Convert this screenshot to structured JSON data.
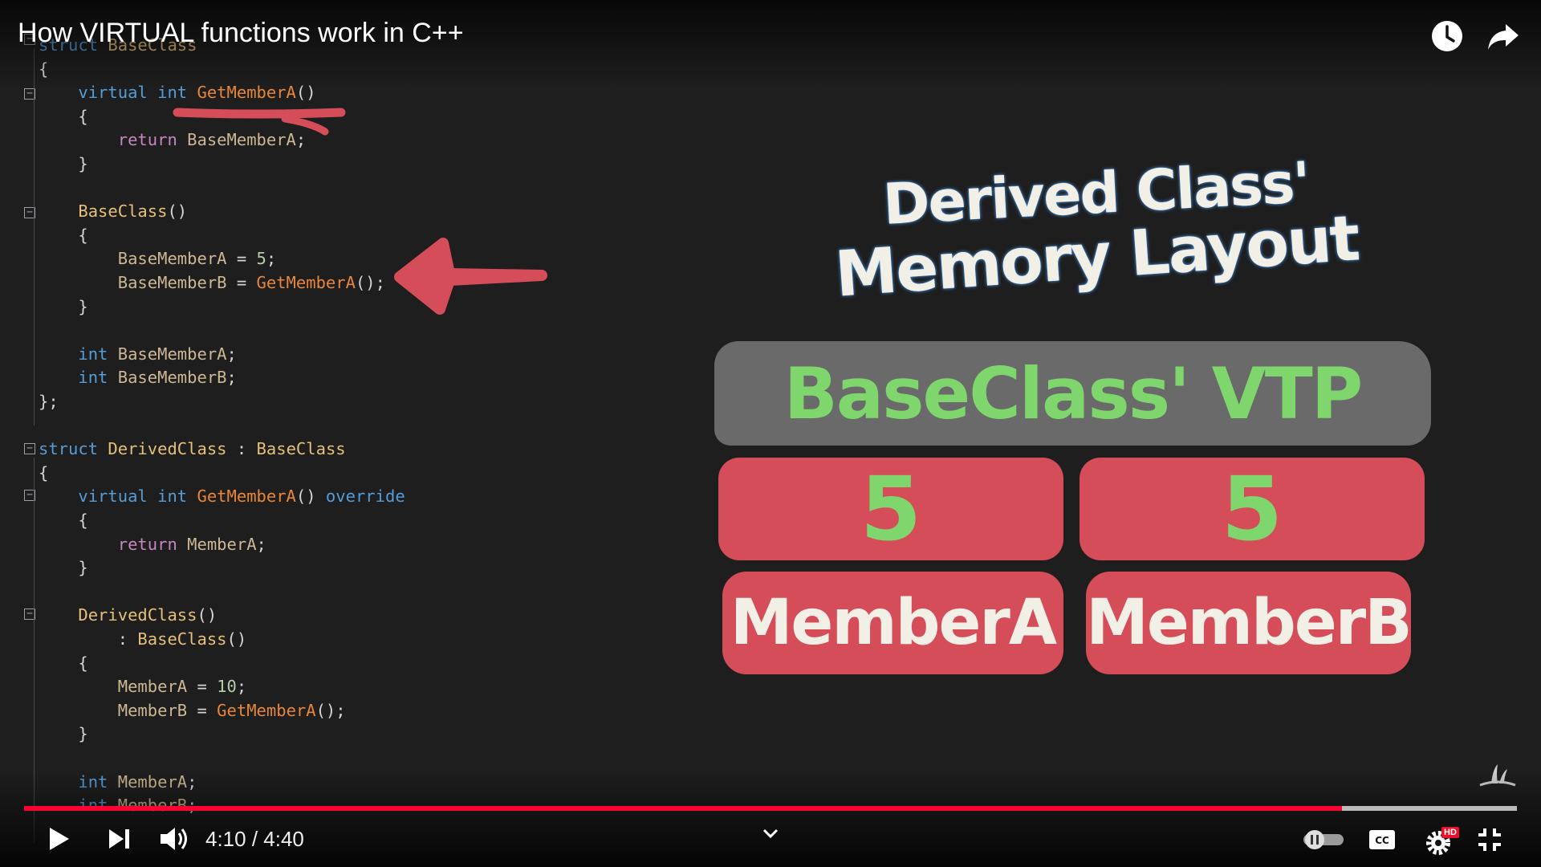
{
  "video": {
    "title": "How VIRTUAL functions work in C++",
    "time_display": "4:10 / 4:40",
    "progress_fraction": 0.883,
    "buffered_fraction": 1.0,
    "hd_badge": "HD"
  },
  "drawing": {
    "heading_line1": "Derived Class'",
    "heading_line2": "Memory Layout",
    "vtp_label": "BaseClass' VTP",
    "value_a": "5",
    "value_b": "5",
    "member_a": "MemberA",
    "member_b": "MemberB"
  },
  "colors": {
    "accent_red": "#d64d5a",
    "vtp_gray": "#6a6a6a",
    "chalk_green": "#7ed66d",
    "chalk_white": "#f2efe6",
    "progress_red": "#ff0033"
  },
  "icons": [
    "watch-later-icon",
    "share-icon",
    "play-icon",
    "next-icon",
    "volume-icon",
    "chevron-down-icon",
    "autoplay-toggle-icon",
    "captions-icon",
    "settings-icon",
    "exit-fullscreen-icon",
    "channel-watermark-icon"
  ],
  "code_lines": [
    [
      {
        "t": "struct",
        "c": "kw"
      },
      {
        "t": " BaseClass",
        "c": "ty"
      }
    ],
    [
      {
        "t": "{",
        "c": "pu"
      }
    ],
    [
      {
        "t": "    virtual",
        "c": "kw"
      },
      {
        "t": " int",
        "c": "kw"
      },
      {
        "t": " GetMemberA",
        "c": "fn"
      },
      {
        "t": "()",
        "c": "pu"
      }
    ],
    [
      {
        "t": "    {",
        "c": "pu"
      }
    ],
    [
      {
        "t": "        return",
        "c": "kw2"
      },
      {
        "t": " BaseMemberA",
        "c": "vr"
      },
      {
        "t": ";",
        "c": "pu"
      }
    ],
    [
      {
        "t": "    }",
        "c": "pu"
      }
    ],
    [
      {
        "t": "",
        "c": "pu"
      }
    ],
    [
      {
        "t": "    BaseClass",
        "c": "ty"
      },
      {
        "t": "()",
        "c": "pu"
      }
    ],
    [
      {
        "t": "    {",
        "c": "pu"
      }
    ],
    [
      {
        "t": "        BaseMemberA",
        "c": "vr"
      },
      {
        "t": " = ",
        "c": "pu"
      },
      {
        "t": "5",
        "c": "nm"
      },
      {
        "t": ";",
        "c": "pu"
      }
    ],
    [
      {
        "t": "        BaseMemberB",
        "c": "vr"
      },
      {
        "t": " = ",
        "c": "pu"
      },
      {
        "t": "GetMemberA",
        "c": "fn"
      },
      {
        "t": "();",
        "c": "pu"
      }
    ],
    [
      {
        "t": "    }",
        "c": "pu"
      }
    ],
    [
      {
        "t": "",
        "c": "pu"
      }
    ],
    [
      {
        "t": "    int",
        "c": "kw"
      },
      {
        "t": " BaseMemberA",
        "c": "vr"
      },
      {
        "t": ";",
        "c": "pu"
      }
    ],
    [
      {
        "t": "    int",
        "c": "kw"
      },
      {
        "t": " BaseMemberB",
        "c": "vr"
      },
      {
        "t": ";",
        "c": "pu"
      }
    ],
    [
      {
        "t": "};",
        "c": "pu"
      }
    ],
    [
      {
        "t": "",
        "c": "pu"
      }
    ],
    [
      {
        "t": "struct",
        "c": "kw"
      },
      {
        "t": " DerivedClass",
        "c": "ty"
      },
      {
        "t": " : ",
        "c": "pu"
      },
      {
        "t": "BaseClass",
        "c": "ty"
      }
    ],
    [
      {
        "t": "{",
        "c": "pu"
      }
    ],
    [
      {
        "t": "    virtual",
        "c": "kw"
      },
      {
        "t": " int",
        "c": "kw"
      },
      {
        "t": " GetMemberA",
        "c": "fn"
      },
      {
        "t": "()",
        "c": "pu"
      },
      {
        "t": " override",
        "c": "kw"
      }
    ],
    [
      {
        "t": "    {",
        "c": "pu"
      }
    ],
    [
      {
        "t": "        return",
        "c": "kw2"
      },
      {
        "t": " MemberA",
        "c": "vr"
      },
      {
        "t": ";",
        "c": "pu"
      }
    ],
    [
      {
        "t": "    }",
        "c": "pu"
      }
    ],
    [
      {
        "t": "",
        "c": "pu"
      }
    ],
    [
      {
        "t": "    DerivedClass",
        "c": "ty"
      },
      {
        "t": "()",
        "c": "pu"
      }
    ],
    [
      {
        "t": "        : ",
        "c": "pu"
      },
      {
        "t": "BaseClass",
        "c": "ty"
      },
      {
        "t": "()",
        "c": "pu"
      }
    ],
    [
      {
        "t": "    {",
        "c": "pu"
      }
    ],
    [
      {
        "t": "        MemberA",
        "c": "vr"
      },
      {
        "t": " = ",
        "c": "pu"
      },
      {
        "t": "10",
        "c": "nm"
      },
      {
        "t": ";",
        "c": "pu"
      }
    ],
    [
      {
        "t": "        MemberB",
        "c": "vr"
      },
      {
        "t": " = ",
        "c": "pu"
      },
      {
        "t": "GetMemberA",
        "c": "fn"
      },
      {
        "t": "();",
        "c": "pu"
      }
    ],
    [
      {
        "t": "    }",
        "c": "pu"
      }
    ],
    [
      {
        "t": "",
        "c": "pu"
      }
    ],
    [
      {
        "t": "    int",
        "c": "kw"
      },
      {
        "t": " MemberA",
        "c": "vr"
      },
      {
        "t": ";",
        "c": "pu"
      }
    ],
    [
      {
        "t": "    int",
        "c": "kw"
      },
      {
        "t": " MemberB",
        "c": "vr"
      },
      {
        "t": ";",
        "c": "pu"
      }
    ]
  ]
}
